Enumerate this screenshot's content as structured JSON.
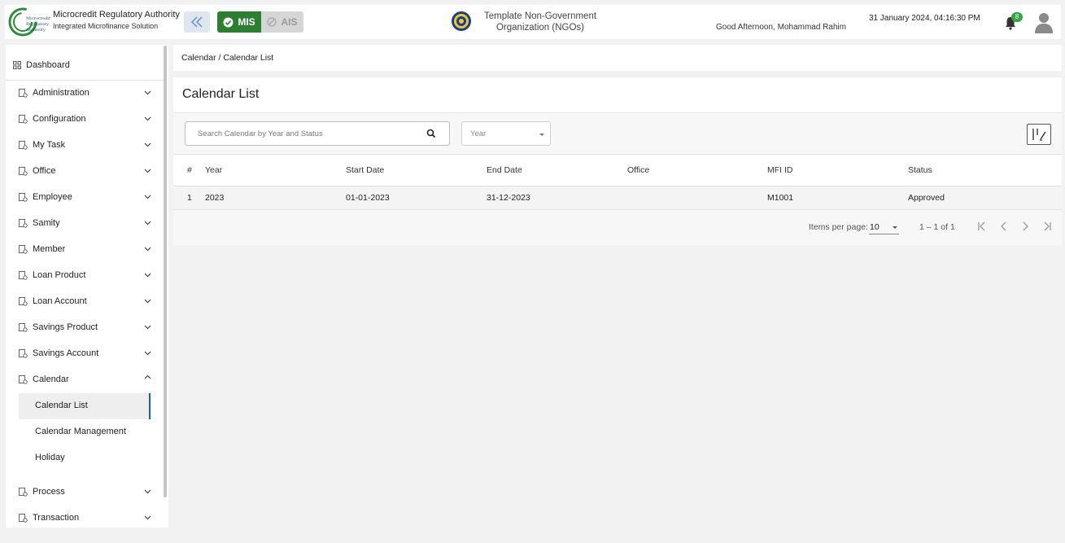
{
  "header": {
    "brand_title": "Microcredit Regulatory Authority",
    "brand_subtitle": "Integrated Microfinance Solution",
    "logo_text": [
      "Microcredit",
      "Regulatory",
      "Authority"
    ],
    "mis_label": "MIS",
    "ais_label": "AIS",
    "org_name_line1": "Template Non-Government",
    "org_name_line2": "Organization (NGOs)",
    "greeting": "Good Afternoon, Mohammad Rahim",
    "datetime": "31 January 2024, 04:16:30 PM",
    "notification_count": "8",
    "icons": [
      "collapse-double-chevron-icon",
      "check-circle-icon",
      "block-icon",
      "emblem-icon",
      "bell-icon",
      "user-avatar-icon"
    ]
  },
  "sidebar": {
    "dashboard": "Dashboard",
    "items": [
      {
        "label": "Administration",
        "icon": "admin-icon",
        "expanded": false
      },
      {
        "label": "Configuration",
        "icon": "sliders-icon",
        "expanded": false
      },
      {
        "label": "My Task",
        "icon": "task-icon",
        "expanded": false
      },
      {
        "label": "Office",
        "icon": "office-icon",
        "expanded": false
      },
      {
        "label": "Employee",
        "icon": "employee-icon",
        "expanded": false
      },
      {
        "label": "Samity",
        "icon": "samity-icon",
        "expanded": false
      },
      {
        "label": "Member",
        "icon": "member-icon",
        "expanded": false
      },
      {
        "label": "Loan Product",
        "icon": "loan-product-icon",
        "expanded": false
      },
      {
        "label": "Loan Account",
        "icon": "loan-account-icon",
        "expanded": false
      },
      {
        "label": "Savings Product",
        "icon": "savings-product-icon",
        "expanded": false
      },
      {
        "label": "Savings Account",
        "icon": "savings-account-icon",
        "expanded": false
      },
      {
        "label": "Calendar",
        "icon": "calendar-icon",
        "expanded": true
      },
      {
        "label": "Process",
        "icon": "process-icon",
        "expanded": false
      },
      {
        "label": "Transaction",
        "icon": "transaction-icon",
        "expanded": false
      }
    ],
    "calendar_sub": [
      {
        "label": "Calendar List",
        "active": true
      },
      {
        "label": "Calendar Management",
        "active": false
      },
      {
        "label": "Holiday",
        "active": false
      }
    ]
  },
  "breadcrumb": "Calendar / Calendar List",
  "page": {
    "title": "Calendar List",
    "search_placeholder": "Search Calendar by Year and Status",
    "year_placeholder": "Year"
  },
  "table": {
    "columns": [
      "#",
      "Year",
      "Start Date",
      "End Date",
      "Office",
      "MFI ID",
      "Status"
    ],
    "rows": [
      [
        "1",
        "2023",
        "01-01-2023",
        "31-12-2023",
        "",
        "M1001",
        "Approved"
      ]
    ]
  },
  "paginator": {
    "items_per_page_label": "Items per page:",
    "page_size": "10",
    "range": "1 – 1 of 1"
  },
  "colors": {
    "accent_green": "#2d7d32",
    "active_border": "#1d5fa8",
    "badge_green": "#3aa345"
  }
}
